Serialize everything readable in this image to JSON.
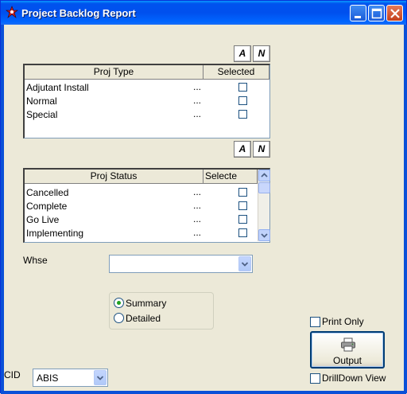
{
  "window": {
    "title": "Project Backlog Report"
  },
  "proj_type": {
    "all_button": "A",
    "none_button": "N",
    "columns": [
      "Proj Type",
      "Selected"
    ],
    "rows": [
      {
        "label": "Adjutant Install",
        "dots": "...",
        "checked": false
      },
      {
        "label": "Normal",
        "dots": "...",
        "checked": false
      },
      {
        "label": "Special",
        "dots": "...",
        "checked": false
      }
    ]
  },
  "proj_status": {
    "all_button": "A",
    "none_button": "N",
    "columns": [
      "Proj Status",
      "Selecte"
    ],
    "rows": [
      {
        "label": "Cancelled",
        "dots": "...",
        "checked": false
      },
      {
        "label": "Complete",
        "dots": "...",
        "checked": false
      },
      {
        "label": "Go Live",
        "dots": "...",
        "checked": false
      },
      {
        "label": "Implementing",
        "dots": "...",
        "checked": false
      }
    ]
  },
  "whse": {
    "label": "Whse",
    "value": ""
  },
  "report_mode": {
    "options": [
      "Summary",
      "Detailed"
    ],
    "selected": "Summary"
  },
  "print_only": {
    "label": "Print Only",
    "checked": false
  },
  "output_button": {
    "label": "Output",
    "icon": "printer-icon"
  },
  "drilldown": {
    "label": "DrillDown View",
    "checked": false
  },
  "cid": {
    "label": "CID",
    "value": "ABIS"
  },
  "colors": {
    "titlebar": "#0053ee",
    "selected_radio": "#21a121",
    "background": "#ece9d8"
  }
}
